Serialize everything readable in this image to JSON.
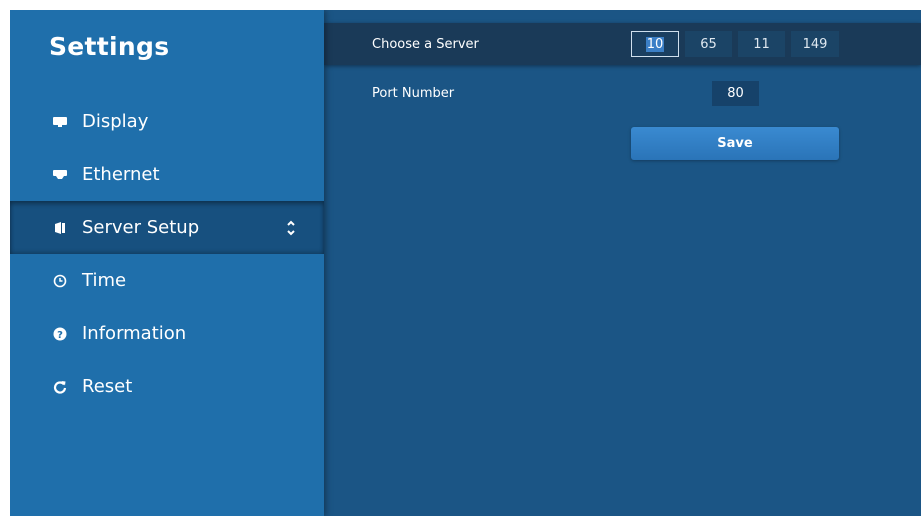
{
  "sidebar": {
    "title": "Settings",
    "items": [
      {
        "label": "Display",
        "icon": "monitor-icon"
      },
      {
        "label": "Ethernet",
        "icon": "ethernet-icon"
      },
      {
        "label": "Server Setup",
        "icon": "server-icon",
        "active": true
      },
      {
        "label": "Time",
        "icon": "clock-icon"
      },
      {
        "label": "Information",
        "icon": "question-icon"
      },
      {
        "label": "Reset",
        "icon": "reset-icon"
      }
    ]
  },
  "server": {
    "label": "Choose a Server",
    "ip": [
      "10",
      "65",
      "11",
      "149"
    ]
  },
  "port": {
    "label": "Port Number",
    "value": "80"
  },
  "save_label": "Save",
  "colors": {
    "sidebar_bg": "#1f6fab",
    "main_bg": "#1b5585",
    "active_item_bg": "#17507f",
    "button_bg": "#3282c6"
  }
}
